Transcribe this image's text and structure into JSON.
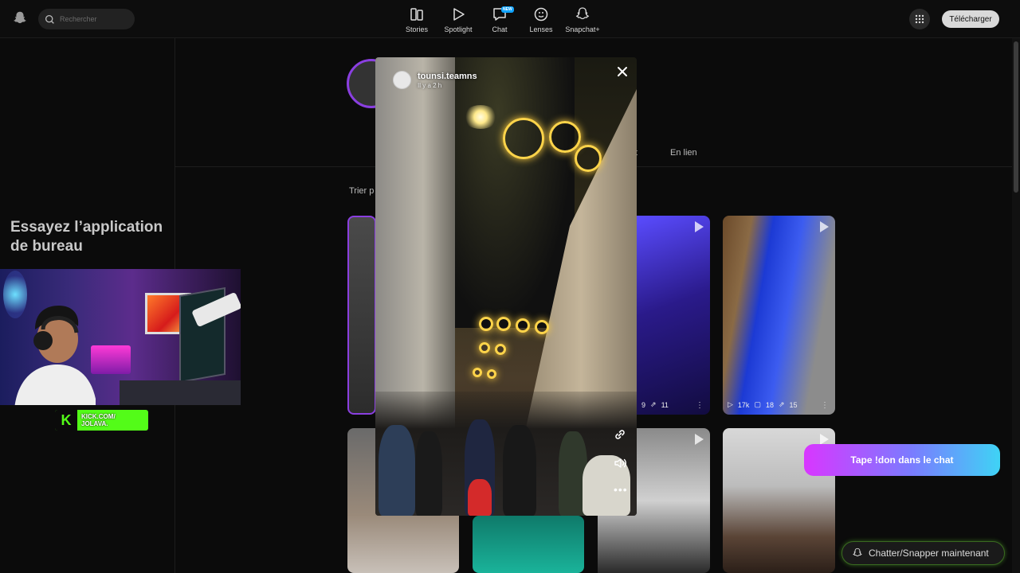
{
  "topbar": {
    "search_placeholder": "Rechercher",
    "nav": [
      {
        "label": "Stories",
        "icon": "stories-icon"
      },
      {
        "label": "Spotlight",
        "icon": "play-icon"
      },
      {
        "label": "Chat",
        "icon": "chat-icon",
        "badge": "NEW"
      },
      {
        "label": "Lenses",
        "icon": "lens-icon"
      },
      {
        "label": "Snapchat+",
        "icon": "ghost-plus-icon"
      }
    ],
    "download_label": "Télécharger"
  },
  "sidebar": {
    "try_title": "Essayez l’application de bureau"
  },
  "overlay": {
    "kick_line1": "KICK.COM/",
    "kick_line2": "JOLAVA."
  },
  "profile": {
    "tab_partial": "t",
    "tab_link": "En lien",
    "sort_label": "Trier p"
  },
  "tiles": [
    {
      "id": "t3",
      "stats": [
        "9",
        "11"
      ]
    },
    {
      "id": "t4",
      "stats": [
        "17k",
        "18",
        "15"
      ]
    }
  ],
  "story": {
    "username": "tounsi.teamns",
    "time": "Il y a 2 h"
  },
  "cta": {
    "don_label": "Tape !don dans le chat",
    "chat_label": "Chatter/Snapper maintenant"
  },
  "colors": {
    "accent_purple": "#8a3fe0",
    "kick_green": "#53fc18"
  }
}
